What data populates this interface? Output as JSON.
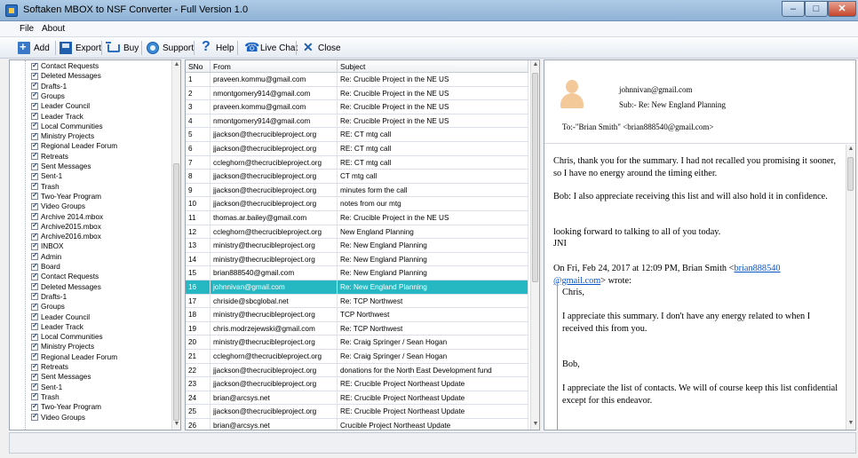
{
  "window": {
    "title": "Softaken MBOX to NSF Converter - Full Version 1.0",
    "minimize": "–",
    "maximize": "□",
    "close": "✕"
  },
  "menu": {
    "file": "File",
    "about": "About"
  },
  "toolbar": {
    "add": "Add",
    "export": "Export",
    "buy": "Buy",
    "support": "Support",
    "help": "Help",
    "live_chat": "Live Chat",
    "close": "Close"
  },
  "tree": {
    "items": [
      "Contact Requests",
      "Deleted Messages",
      "Drafts-1",
      "Groups",
      "Leader Council",
      "Leader Track",
      "Local Communities",
      "Ministry Projects",
      "Regional Leader Forum",
      "Retreats",
      "Sent Messages",
      "Sent-1",
      "Trash",
      "Two-Year Program",
      "Video Groups",
      "Archive 2014.mbox",
      "Archive2015.mbox",
      "Archive2016.mbox",
      "INBOX",
      "Admin",
      "Board",
      "Contact Requests",
      "Deleted Messages",
      "Drafts-1",
      "Groups",
      "Leader Council",
      "Leader Track",
      "Local Communities",
      "Ministry Projects",
      "Regional Leader Forum",
      "Retreats",
      "Sent Messages",
      "Sent-1",
      "Trash",
      "Two-Year Program",
      "Video Groups"
    ]
  },
  "list": {
    "headers": {
      "sno": "SNo",
      "from": "From",
      "subject": "Subject"
    },
    "selected_index": 15,
    "rows": [
      [
        "1",
        "praveen.kommu@gmail.com",
        "Re: Crucible Project in the NE US"
      ],
      [
        "2",
        "nmontgomery914@gmail.com",
        "Re: Crucible Project in the NE US"
      ],
      [
        "3",
        "praveen.kommu@gmail.com",
        "Re: Crucible Project in the NE US"
      ],
      [
        "4",
        "nmontgomery914@gmail.com",
        "Re: Crucible Project in the NE US"
      ],
      [
        "5",
        "jjackson@thecrucibleproject.org",
        "RE: CT mtg call"
      ],
      [
        "6",
        "jjackson@thecrucibleproject.org",
        "RE: CT mtg call"
      ],
      [
        "7",
        "ccleghorn@thecrucibleproject.org",
        "RE: CT mtg call"
      ],
      [
        "8",
        "jjackson@thecrucibleproject.org",
        "CT mtg call"
      ],
      [
        "9",
        "jjackson@thecrucibleproject.org",
        "minutes form the call"
      ],
      [
        "10",
        "jjackson@thecrucibleproject.org",
        "notes from our mtg"
      ],
      [
        "11",
        "thomas.ar.bailey@gmail.com",
        "Re: Crucible Project in the NE US"
      ],
      [
        "12",
        "ccleghorn@thecrucibleproject.org",
        "New England Planning"
      ],
      [
        "13",
        "ministry@thecrucibleproject.org",
        "Re: New England Planning"
      ],
      [
        "14",
        "ministry@thecrucibleproject.org",
        "Re: New England Planning"
      ],
      [
        "15",
        "brian888540@gmail.com",
        "Re: New England Planning"
      ],
      [
        "16",
        "johnnivan@gmail.com",
        "Re: New England Planning"
      ],
      [
        "17",
        "chriside@sbcglobal.net",
        "Re: TCP Northwest"
      ],
      [
        "18",
        "ministry@thecrucibleproject.org",
        "TCP Northwest"
      ],
      [
        "19",
        "chris.modrzejewski@gmail.com",
        "Re: TCP Northwest"
      ],
      [
        "20",
        "ministry@thecrucibleproject.org",
        "Re: Craig Springer / Sean Hogan"
      ],
      [
        "21",
        "ccleghorn@thecrucibleproject.org",
        "Re: Craig Springer / Sean Hogan"
      ],
      [
        "22",
        "jjackson@thecrucibleproject.org",
        "donations for the North East Development fund"
      ],
      [
        "23",
        "jjackson@thecrucibleproject.org",
        "RE: Crucible Project Northeast Update"
      ],
      [
        "24",
        "brian@arcsys.net",
        "RE: Crucible Project Northeast Update"
      ],
      [
        "25",
        "jjackson@thecrucibleproject.org",
        "RE: Crucible Project Northeast Update"
      ],
      [
        "26",
        "brian@arcsys.net",
        "Crucible Project Northeast Update"
      ]
    ]
  },
  "preview": {
    "from": "johnnivan@gmail.com",
    "subject": "Sub:- Re: New England Planning",
    "to": "To:-\"Brian Smith\" <brian888540@gmail.com>",
    "body": {
      "p1": "Chris, thank you for the summary. I had not recalled you promising it sooner, so I have no energy around the timing either.",
      "p2": "Bob: I also appreciate receiving this list and will also hold it in confidence.",
      "p3a": "looking forward to talking to all of you today.",
      "p3b": "JNI",
      "on_prefix": "On Fri, Feb 24, 2017 at 12:09 PM, Brian Smith <",
      "link1": "brian888540",
      "link2": "@gmail.com",
      "on_suffix": "> wrote:",
      "q1": "Chris,",
      "q2": "I appreciate this summary.  I don't have any energy related to when I received this from you.",
      "q3": "Bob,",
      "q4": "I appreciate the list of contacts.  We will of course keep this list confidential except for this endeavor."
    }
  },
  "colors": {
    "selected_row": "#25b8c2",
    "link": "#0b55c7"
  }
}
